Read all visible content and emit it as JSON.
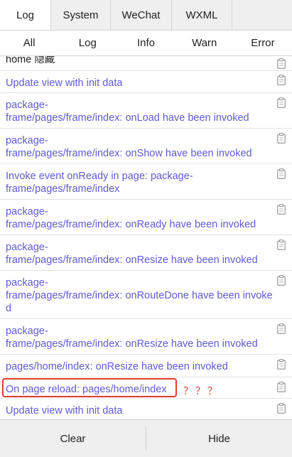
{
  "tabs": [
    "Log",
    "System",
    "WeChat",
    "WXML"
  ],
  "active_tab": "Log",
  "filters": [
    "All",
    "Log",
    "Info",
    "Warn",
    "Error"
  ],
  "logs": [
    {
      "text": "home 隐藏",
      "dark": true
    },
    {
      "text": "Update view with init data"
    },
    {
      "text": "package-\nframe/pages/frame/index: onLoad have been invoked"
    },
    {
      "text": "package-\nframe/pages/frame/index: onShow have been invoked"
    },
    {
      "text": "Invoke event onReady in page: package-\nframe/pages/frame/index"
    },
    {
      "text": "package-\nframe/pages/frame/index: onReady have been invoked"
    },
    {
      "text": "package-\nframe/pages/frame/index: onResize have been invoked"
    },
    {
      "text": "package-\nframe/pages/frame/index: onRouteDone have been invoke\nd"
    },
    {
      "text": "package-\nframe/pages/frame/index: onResize have been invoked"
    },
    {
      "text": "pages/home/index: onResize have been invoked"
    },
    {
      "text": "On page reload: pages/home/index"
    },
    {
      "text": "Update view with init data"
    }
  ],
  "annotation": {
    "text": "？？？",
    "color": "#e23b2c"
  },
  "colors": {
    "log_text": "#5e5ad6",
    "accent": "#e23b2c"
  },
  "bottom": {
    "clear_label": "Clear",
    "hide_label": "Hide"
  }
}
